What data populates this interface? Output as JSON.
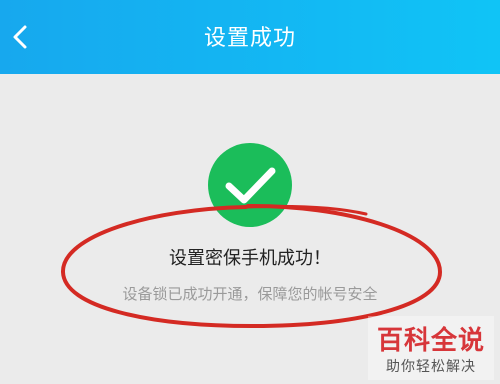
{
  "header": {
    "title": "设置成功",
    "back_icon": "chevron-left-icon"
  },
  "success": {
    "icon": "checkmark-circle-icon",
    "icon_color": "#1bbd5a",
    "title": "设置密保手机成功！",
    "subtitle": "设备锁已成功开通，保障您的帐号安全"
  },
  "annotation": {
    "shape": "red-ellipse",
    "color": "#d42a23"
  },
  "watermark": {
    "title": "百科全说",
    "subtitle": "助你轻松解决"
  }
}
